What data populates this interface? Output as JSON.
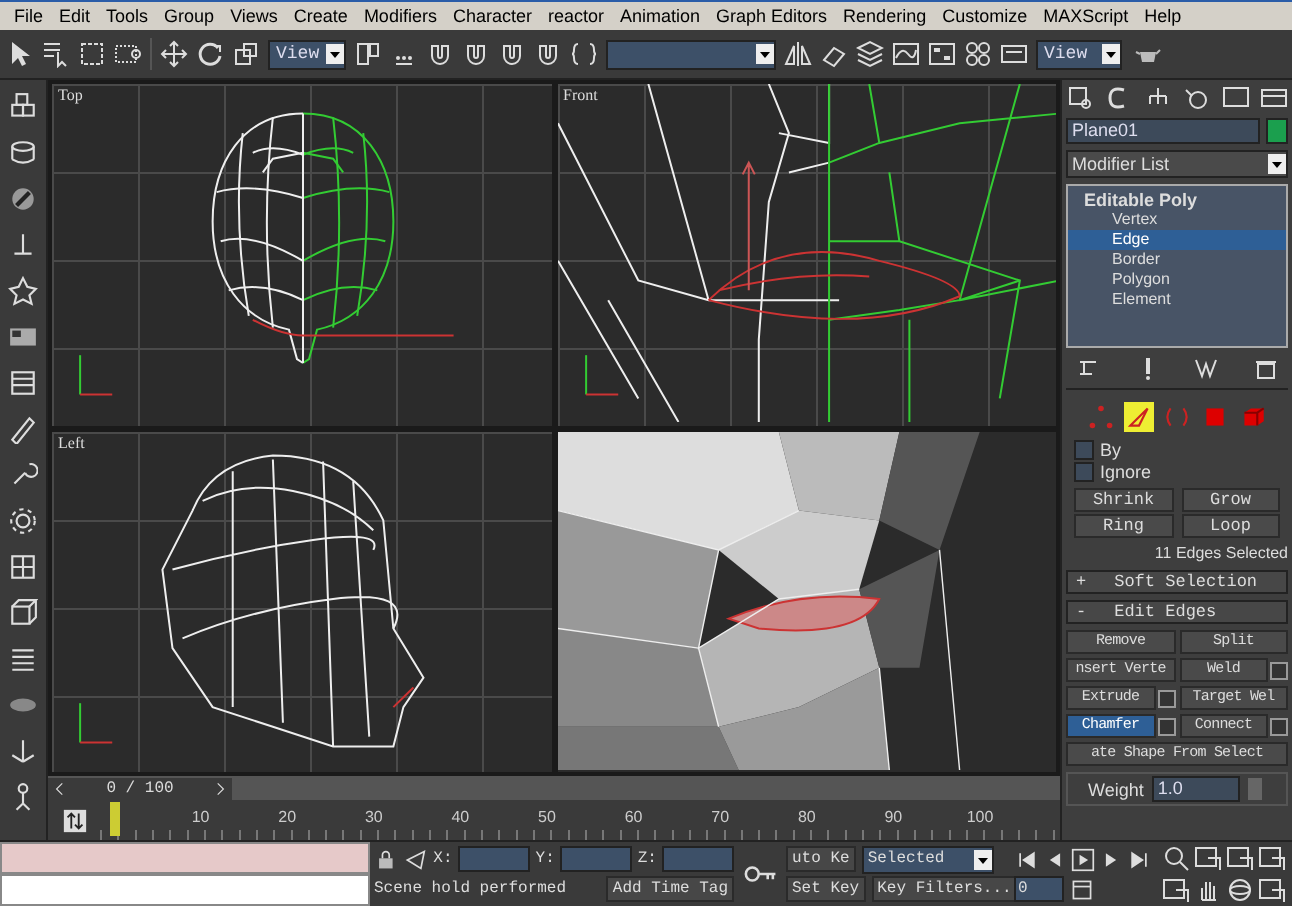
{
  "menu": [
    "File",
    "Edit",
    "Tools",
    "Group",
    "Views",
    "Create",
    "Modifiers",
    "Character",
    "reactor",
    "Animation",
    "Graph Editors",
    "Rendering",
    "Customize",
    "MAXScript",
    "Help"
  ],
  "toolbar": {
    "reference_coordinate": "View",
    "render_preset": "View"
  },
  "viewports": [
    {
      "kind": "top",
      "label": "Top"
    },
    {
      "kind": "front",
      "label": "Front"
    },
    {
      "kind": "left",
      "label": "Left"
    },
    {
      "kind": "perspective"
    }
  ],
  "command_panel": {
    "object_name": "Plane01",
    "modifier_list": "Modifier List",
    "modifier_stack": [
      {
        "label": "Editable Poly",
        "selected": false,
        "children": [
          {
            "label": "Vertex",
            "selected": false
          },
          {
            "label": "Edge",
            "selected": true
          },
          {
            "label": "Border",
            "selected": false
          },
          {
            "label": "Polygon",
            "selected": false
          },
          {
            "label": "Element",
            "selected": false
          }
        ]
      }
    ],
    "subobject_levels": [
      {
        "kind": "vertex",
        "selected": false
      },
      {
        "kind": "edge",
        "selected": true
      },
      {
        "kind": "border",
        "selected": false
      },
      {
        "kind": "polygon",
        "selected": false
      },
      {
        "kind": "element",
        "selected": false
      }
    ],
    "checkboxes": [
      {
        "label": "By",
        "checked": false
      },
      {
        "label": "Ignore",
        "checked": false
      }
    ],
    "selection_buttons": [
      "Shrink",
      "Grow",
      "Ring",
      "Loop"
    ],
    "selection_info": "11 Edges Selected",
    "rollouts": [
      {
        "sign": "+",
        "label": "Soft Selection"
      },
      {
        "sign": "-",
        "label": "Edit Edges"
      }
    ],
    "edit_edges": [
      {
        "label": "Remove",
        "kind": "half",
        "settings": false,
        "selected": false
      },
      {
        "label": "Split",
        "kind": "half",
        "settings": false,
        "selected": false
      },
      {
        "label": "nsert Verte",
        "kind": "half",
        "settings": false,
        "selected": false
      },
      {
        "label": "Weld",
        "kind": "half",
        "settings": true,
        "selected": false
      },
      {
        "label": "Extrude",
        "kind": "half",
        "settings": true,
        "selected": false
      },
      {
        "label": "Target Wel",
        "kind": "half",
        "settings": false,
        "selected": false
      },
      {
        "label": "Chamfer",
        "kind": "half",
        "settings": true,
        "selected": true
      },
      {
        "label": "Connect",
        "kind": "half",
        "settings": true,
        "selected": false
      },
      {
        "label": "ate Shape From Select",
        "kind": "full",
        "settings": false,
        "selected": false
      }
    ],
    "weight_label": "Weight",
    "weight_value": "1.0"
  },
  "time_slider": {
    "text": "0 / 100",
    "level": 0
  },
  "trackbar": {
    "ticks": [
      "10",
      "20",
      "30",
      "40",
      "50",
      "60",
      "70",
      "80",
      "90",
      "100"
    ]
  },
  "status": {
    "coords": [
      "X:",
      "Y:",
      "Z:"
    ],
    "prompt": "Scene hold performed",
    "time_tag": "Add Time Tag",
    "auto_key": "uto Ke",
    "key_mode": "Selected",
    "set_key": "Set Key",
    "key_filters": "Key Filters...",
    "frame": "0"
  }
}
